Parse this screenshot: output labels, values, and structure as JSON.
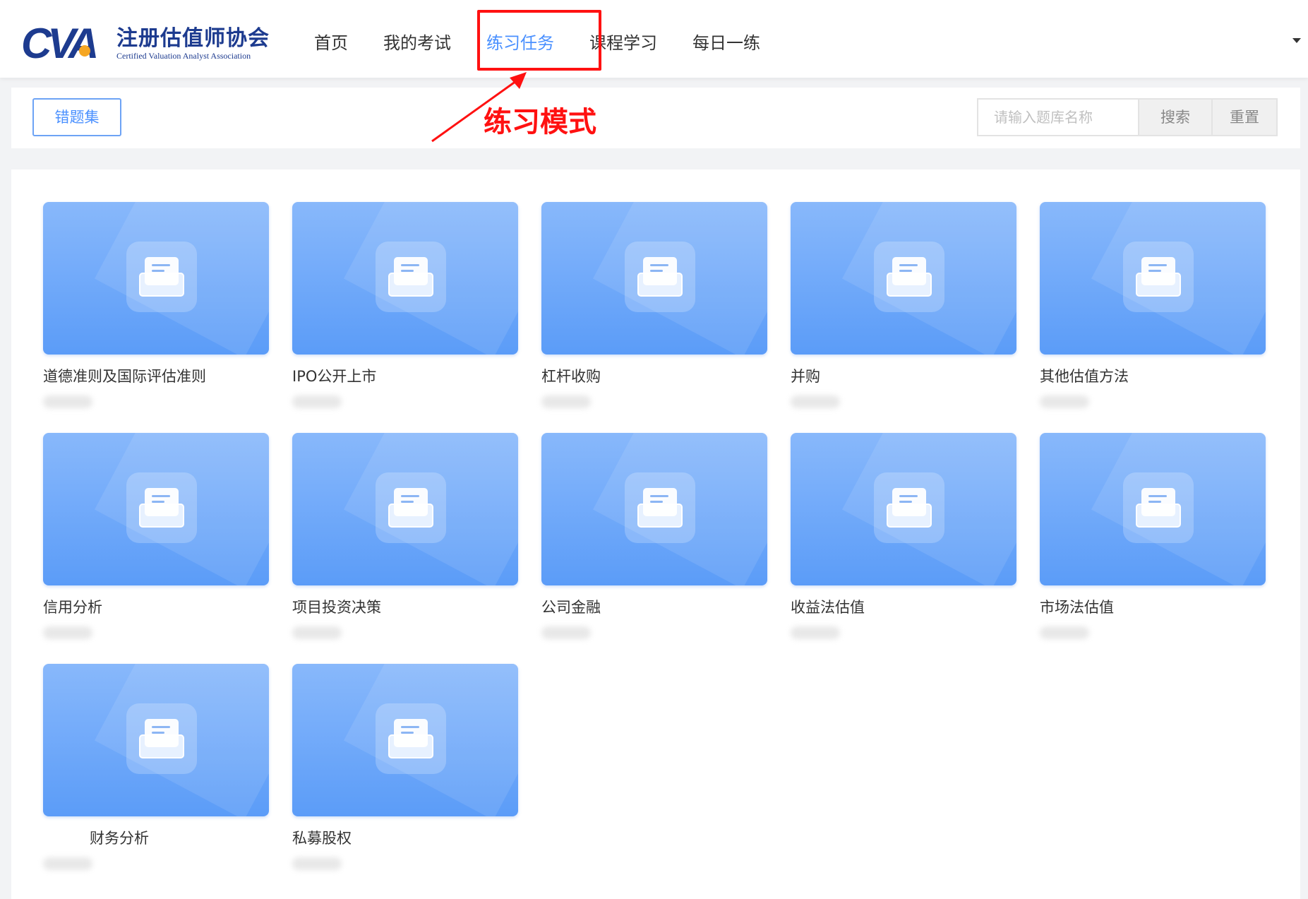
{
  "header": {
    "logo_mark": "CVA",
    "logo_cn": "注册估值师协会",
    "logo_en": "Certified Valuation Analyst Association",
    "nav": [
      "首页",
      "我的考试",
      "练习任务",
      "课程学习",
      "每日一练"
    ],
    "active_nav": "练习任务"
  },
  "toolbar": {
    "wrong_set_label": "错题集",
    "annotation": "练习模式",
    "search_placeholder": "请输入题库名称",
    "search_label": "搜索",
    "reset_label": "重置"
  },
  "colors": {
    "accent": "#4a90ff",
    "annotation_red": "#ff1111",
    "logo_navy": "#1d3b8f",
    "logo_orange": "#f5a623"
  },
  "cards": [
    {
      "title": "道德准则及国际评估准则"
    },
    {
      "title": "IPO公开上市"
    },
    {
      "title": "杠杆收购"
    },
    {
      "title": "并购"
    },
    {
      "title": "其他估值方法"
    },
    {
      "title": "信用分析"
    },
    {
      "title": "项目投资决策"
    },
    {
      "title": "公司金融"
    },
    {
      "title": "收益法估值"
    },
    {
      "title": "市场法估值"
    },
    {
      "title": "财务分析"
    },
    {
      "title": "私募股权"
    }
  ]
}
